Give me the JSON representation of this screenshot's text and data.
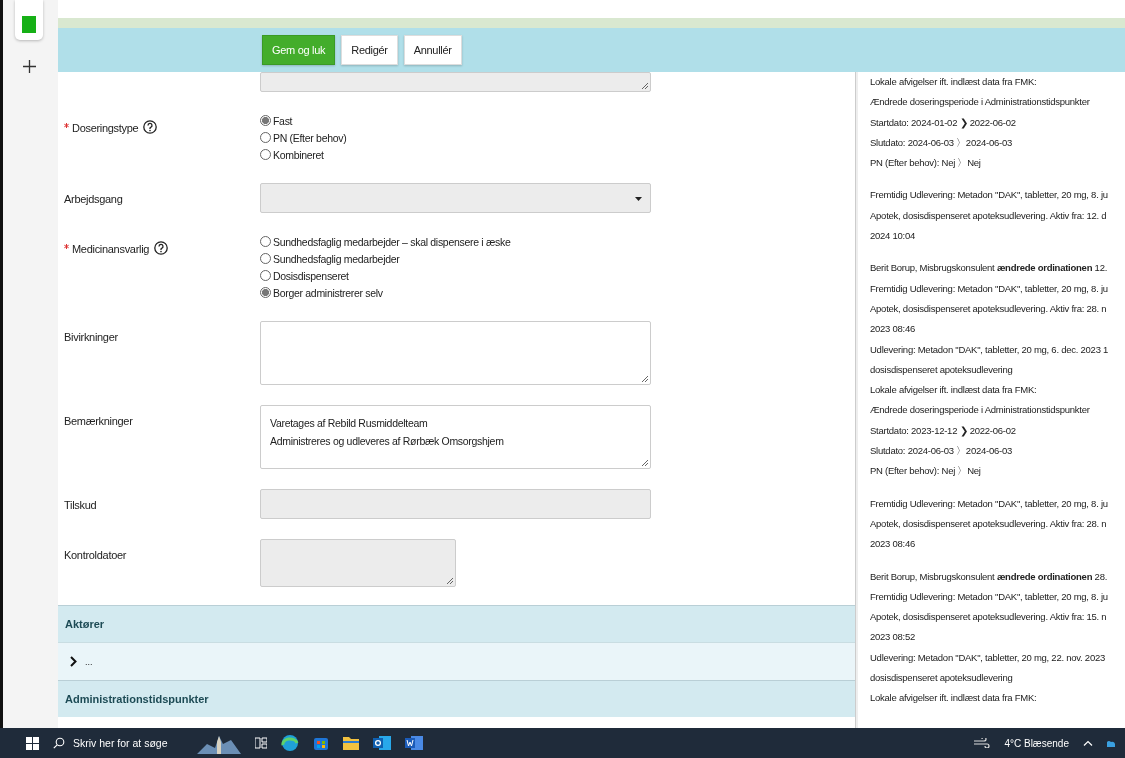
{
  "toolbar": {
    "buttons": [
      {
        "label": "Gem og luk",
        "kind": "primary"
      },
      {
        "label": "Redigér",
        "kind": "default"
      },
      {
        "label": "Annullér",
        "kind": "default"
      }
    ]
  },
  "form": {
    "fields": [
      {
        "kind": "textarea",
        "disabled": true
      },
      {
        "kind": "radio",
        "label": "Doseringstype",
        "required": true,
        "help": true,
        "options": [
          {
            "label": "Fast",
            "selected": true
          },
          {
            "label": "PN (Efter behov)",
            "selected": false
          },
          {
            "label": "Kombineret",
            "selected": false
          }
        ]
      },
      {
        "kind": "select",
        "label": "Arbejdsgang",
        "required": false,
        "help": false,
        "disabled": true
      },
      {
        "kind": "radio",
        "label": "Medicinansvarlig",
        "required": true,
        "help": true,
        "options": [
          {
            "label": "Sundhedsfaglig medarbejder – skal dispensere i æske",
            "selected": false
          },
          {
            "label": "Sundhedsfaglig medarbejder",
            "selected": false
          },
          {
            "label": "Dosisdispenseret",
            "selected": false
          },
          {
            "label": "Borger administrerer selv",
            "selected": true
          }
        ]
      },
      {
        "kind": "textarea",
        "label": "Bivirkninger",
        "required": false,
        "help": false,
        "disabled": false
      },
      {
        "kind": "textarea",
        "label": "Bemærkninger",
        "required": false,
        "help": false,
        "disabled": false,
        "value": [
          "Varetages af Rebild Rusmiddelteam",
          "Administreres og udleveres af Rørbæk Omsorgshjem"
        ]
      },
      {
        "kind": "input",
        "label": "Tilskud",
        "required": false,
        "help": false,
        "disabled": true
      },
      {
        "kind": "textarea",
        "label": "Kontroldatoer",
        "required": false,
        "help": false,
        "disabled": true
      }
    ]
  },
  "sections": [
    {
      "kind": "header",
      "title": "Aktører"
    },
    {
      "kind": "row",
      "text": "..."
    },
    {
      "kind": "header",
      "title": "Administrationstidspunkter"
    }
  ],
  "history": [
    {
      "lines": [
        "Lokale afvigelser ift. indlæst data fra FMK:",
        "Ændrede doseringsperiode i Administrationstidspunkter",
        "Startdato: 2024-01-02 ❯ 2022-06-02",
        "Slutdato: 2024-06-03 〉2024-06-03",
        "PN (Efter behov): Nej 〉Nej"
      ]
    },
    {
      "lines": [
        "Fremtidig Udlevering: Metadon \"DAK\", tabletter, 20 mg, 8. ju",
        "Apotek, dosisdispenseret apoteksudlevering. Aktiv fra: 12. d",
        "2024 10:04"
      ]
    },
    {
      "lines": [
        "Berit Borup, Misbrugskonsulent **ændrede ordinationen** 12.",
        "Fremtidig Udlevering: Metadon \"DAK\", tabletter, 20 mg, 8. ju",
        "Apotek, dosisdispenseret apoteksudlevering. Aktiv fra: 28. n",
        "2023 08:46",
        "Udlevering: Metadon \"DAK\", tabletter, 20 mg, 6. dec. 2023 1",
        "dosisdispenseret apoteksudlevering",
        "Lokale afvigelser ift. indlæst data fra FMK:",
        "Ændrede doseringsperiode i Administrationstidspunkter",
        "Startdato: 2023-12-12 ❯ 2022-06-02",
        "Slutdato: 2024-06-03 〉2024-06-03",
        "PN (Efter behov): Nej 〉Nej"
      ]
    },
    {
      "lines": [
        "Fremtidig Udlevering: Metadon \"DAK\", tabletter, 20 mg, 8. ju",
        "Apotek, dosisdispenseret apoteksudlevering. Aktiv fra: 28. n",
        "2023 08:46"
      ]
    },
    {
      "lines": [
        "Berit Borup, Misbrugskonsulent **ændrede ordinationen** 28.",
        "Fremtidig Udlevering: Metadon \"DAK\", tabletter, 20 mg, 8. ju",
        "Apotek, dosisdispenseret apoteksudlevering. Aktiv fra: 15. n",
        "2023 08:52",
        "Udlevering: Metadon \"DAK\", tabletter, 20 mg, 22. nov. 2023",
        "dosisdispenseret apoteksudlevering",
        "Lokale afvigelser ift. indlæst data fra FMK:"
      ]
    }
  ],
  "taskbar": {
    "search_placeholder": "Skriv her for at søge",
    "weather": "4°C  Blæsende"
  }
}
